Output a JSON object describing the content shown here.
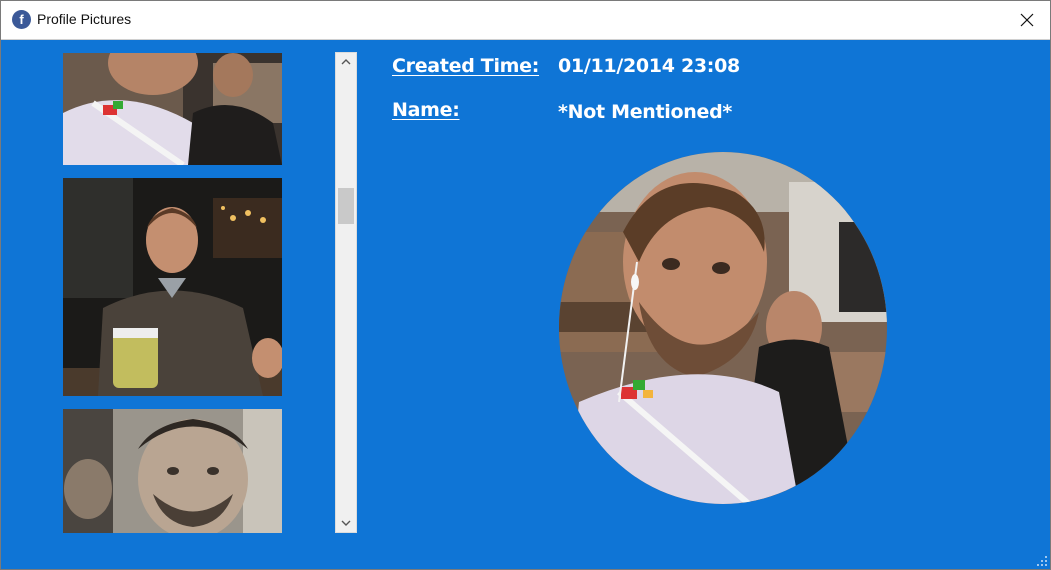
{
  "window": {
    "title": "Profile Pictures",
    "app_icon": "facebook-icon",
    "app_icon_letter": "f",
    "close_icon": "close-icon"
  },
  "details": {
    "created_time_label": "Created Time:",
    "created_time_value": "01/11/2014 23:08",
    "name_label": "Name:",
    "name_value": "*Not Mentioned*"
  },
  "thumbnails": [
    {
      "description_icon": "profile-thumbnail"
    },
    {
      "description_icon": "profile-thumbnail"
    },
    {
      "description_icon": "profile-thumbnail"
    }
  ],
  "colors": {
    "background": "#0f75d6",
    "text": "#ffffff"
  }
}
